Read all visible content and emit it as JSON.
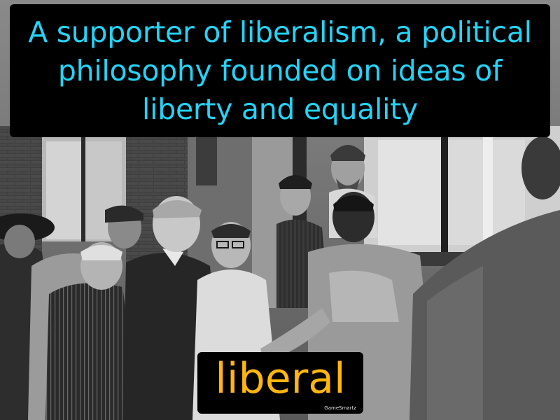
{
  "definition": "A supporter of liberalism, a political philosophy founded on ideas of liberty and equality",
  "term": "liberal",
  "brand": "GameSmartz",
  "colors": {
    "definition_text": "#26d3f5",
    "term_text": "#ffb60e",
    "label_background": "#000000"
  }
}
